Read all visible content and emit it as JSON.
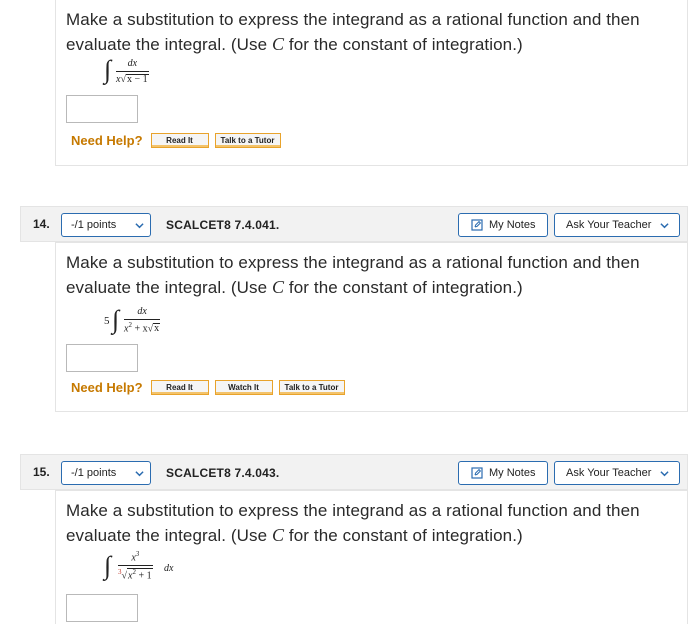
{
  "help_label": "Need Help?",
  "prompt": {
    "line1": "Make a substitution to express the integrand as a rational function and then",
    "line2_a": "evaluate the integral. (Use ",
    "line2_c": "C",
    "line2_b": " for the constant of integration.)"
  },
  "buttons": {
    "read_it": "Read It",
    "watch_it": "Watch It",
    "talk_to_tutor": "Talk to a Tutor",
    "my_notes": "My Notes",
    "ask_teacher": "Ask Your Teacher"
  },
  "question13": {
    "integrand_num": "dx",
    "integrand_den_x": "x",
    "integrand_den_rad": "x − 1"
  },
  "question14": {
    "number": "14.",
    "points": "-/1 points",
    "reference": "SCALCET8 7.4.041.",
    "root_index": "5",
    "integrand_num": "dx",
    "integrand_den_a": "x",
    "integrand_den_exp": "2",
    "integrand_den_b": " + x",
    "integrand_den_rad": "x"
  },
  "question15": {
    "number": "15.",
    "points": "-/1 points",
    "reference": "SCALCET8 7.4.043.",
    "integrand_num_base": "x",
    "integrand_num_exp": "3",
    "root_index": "3",
    "integrand_den_rad_a": "x",
    "integrand_den_exp": "2",
    "integrand_den_rad_b": " + 1",
    "differential": "dx"
  },
  "colors": {
    "accent_blue": "#2b6cb0",
    "help_orange": "#c67900",
    "button_border": "#e8a32c"
  }
}
